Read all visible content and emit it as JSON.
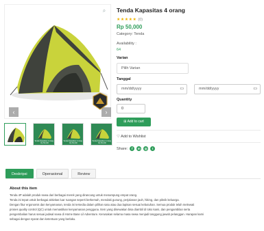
{
  "product": {
    "title": "Tenda Kapasitas 4 orang",
    "stars": "★★★★★",
    "rating_count": "(0)",
    "price": "Rp 50,000",
    "category": "Category: Tenda",
    "availability_label": "Availability :",
    "availability_value": "64",
    "thumb_captions": [
      "Tenda Kapasitas 4 orang · Rp 50,000",
      "Tenda Kapasitas 4 orang · Rp 50,000",
      "Tenda Kapasitas 4 orang · Rp 50,000"
    ]
  },
  "form": {
    "variant_label": "Varian",
    "variant_value": "Pilih Varian",
    "date_label": "Tanggal",
    "date_start_placeholder": "mm/dd/yyyy",
    "date_end_placeholder": "mm/dd/yyyy",
    "quantity_label": "Quantity",
    "quantity_value": "0",
    "add_to_cart": "Add to cart",
    "wishlist": "Add to Wishlist",
    "share_label": "Share:"
  },
  "tabs": [
    "Deskripsi",
    "Operasional",
    "Review"
  ],
  "description": {
    "heading": "About this item",
    "lines": [
      "Tenda 4P adalah produk sewa dari berbagai merek yang dirancang untuk menampung empat orang.",
      "Tenda ini tepat untuk berbagai aktivitas luar ruangan seperti berkemah, mendaki gunung, perjalanan jauh, hiking, dan piknik keluarga.",
      "Dengan fitur ergonomis dan kenyamanan, tenda ini tersedia dalam pilihan satu atau dua lapisan sesuai kebutuhan. Semua produk telah melewati",
      "proses quality control (QC) untuk memastikan kenyamanan pengguna. Item yang disewakan bisa diambil di toko kami, dan pengambilan serta",
      "pengembalian harus sesuai jadwal sewa di Home Base Lil Adventure. Kerusakan selama masa sewa menjadi tanggung jawab pelanggan. Harapan kami",
      "sebagai dengan syarat dan ketentuan yang berlaku."
    ]
  },
  "colors": {
    "accent": "#2e9d5a",
    "star": "#f0b400",
    "tent_body": "#c8d23a",
    "tent_dark": "#3c3f3a"
  },
  "icons": [
    "zoom-icon",
    "chevron-left-icon",
    "chevron-right-icon",
    "calendar-icon",
    "heart-icon",
    "facebook-icon",
    "messenger-icon",
    "instagram-icon",
    "twitter-icon"
  ]
}
